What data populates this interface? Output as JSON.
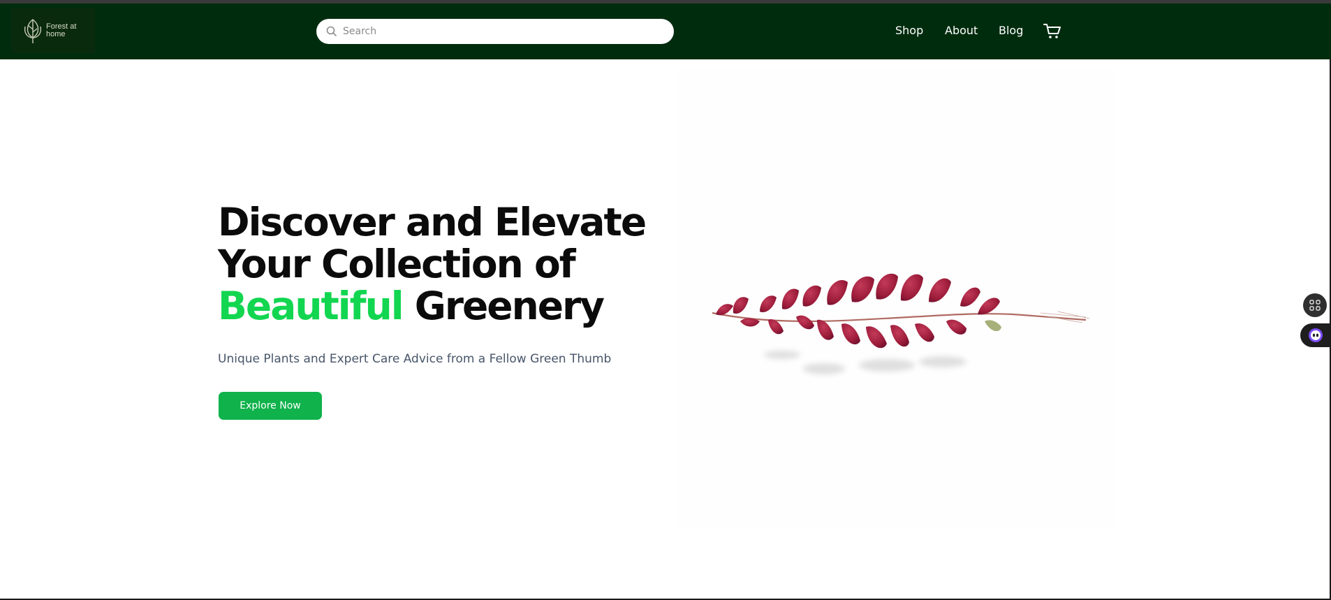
{
  "header": {
    "logo_text": "Forest at home",
    "search": {
      "placeholder": "Search"
    },
    "nav": [
      {
        "label": "Shop"
      },
      {
        "label": "About"
      },
      {
        "label": "Blog"
      }
    ],
    "cart_icon": "cart-icon",
    "background_color": "#002c0e"
  },
  "hero": {
    "title_line1": "Discover and Elevate",
    "title_line2": "Your Collection of",
    "title_accent": "Beautiful",
    "title_end": " Greenery",
    "subtitle": "Unique Plants and Expert Care Advice from a Fellow Green Thumb",
    "cta_label": "Explore Now",
    "accent_color": "#12d650",
    "button_color": "#0fb24b",
    "image_icon": "red-leaf-branch-image"
  },
  "widgets": [
    {
      "icon": "grid-icon"
    },
    {
      "icon": "assistant-icon"
    }
  ]
}
